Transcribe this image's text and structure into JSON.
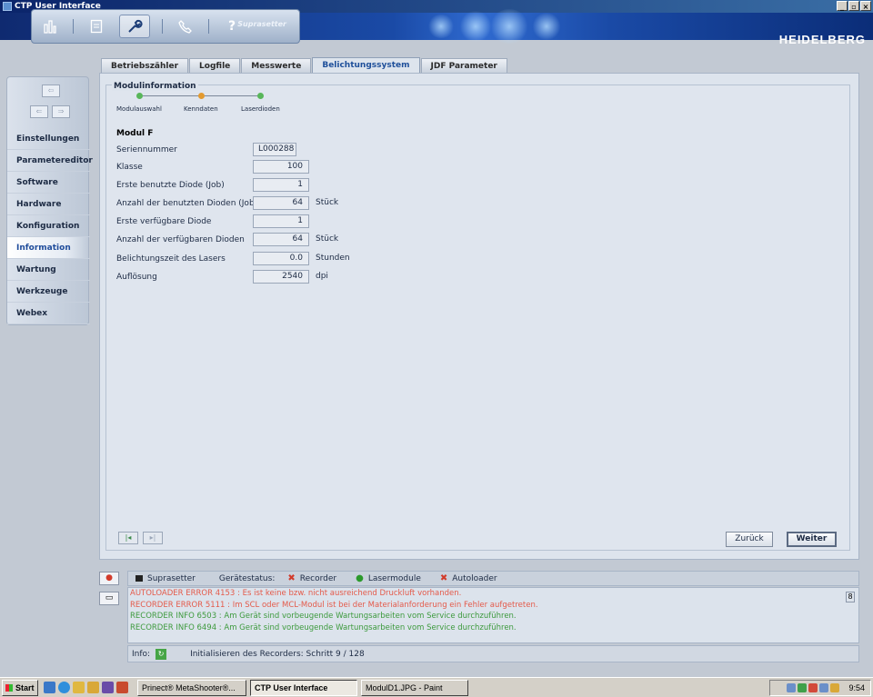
{
  "window": {
    "title": "CTP User Interface"
  },
  "header": {
    "product": "Suprasetter",
    "brand": "HEIDELBERG"
  },
  "sidebar": {
    "items": [
      {
        "label": "Einstellungen"
      },
      {
        "label": "Parametereditor"
      },
      {
        "label": "Software"
      },
      {
        "label": "Hardware"
      },
      {
        "label": "Konfiguration"
      },
      {
        "label": "Information",
        "active": true
      },
      {
        "label": "Wartung"
      },
      {
        "label": "Werkzeuge"
      },
      {
        "label": "Webex"
      }
    ]
  },
  "tabs": [
    {
      "label": "Betriebszähler"
    },
    {
      "label": "Logfile"
    },
    {
      "label": "Messwerte"
    },
    {
      "label": "Belichtungssystem",
      "active": true
    },
    {
      "label": "JDF Parameter"
    }
  ],
  "panel": {
    "legend": "Modulinformation",
    "steps": [
      {
        "label": "Modulauswahl",
        "color": "#58b65a"
      },
      {
        "label": "Kenndaten",
        "color": "#e39a2f"
      },
      {
        "label": "Laserdioden",
        "color": "#58b65a"
      }
    ],
    "module_title": "Modul F",
    "rows": [
      {
        "label": "Seriennummer",
        "value": "L000288",
        "unit": ""
      },
      {
        "label": "Klasse",
        "value": "100",
        "unit": ""
      },
      {
        "label": "Erste benutzte Diode (Job)",
        "value": "1",
        "unit": ""
      },
      {
        "label": "Anzahl der benutzten Dioden (Job)",
        "value": "64",
        "unit": "Stück"
      },
      {
        "label": "Erste verfügbare Diode",
        "value": "1",
        "unit": ""
      },
      {
        "label": "Anzahl der verfügbaren Dioden",
        "value": "64",
        "unit": "Stück"
      },
      {
        "label": "Belichtungszeit des Lasers",
        "value": "0.0",
        "unit": "Stunden"
      },
      {
        "label": "Auflösung",
        "value": "2540",
        "unit": "dpi"
      }
    ],
    "back_label": "Zurück",
    "next_label": "Weiter"
  },
  "status": {
    "device": "Suprasetter",
    "device_status_label": "Gerätestatus:",
    "items": [
      {
        "label": "Recorder",
        "state": "error"
      },
      {
        "label": "Lasermodule",
        "state": "ok"
      },
      {
        "label": "Autoloader",
        "state": "error"
      }
    ],
    "count": "8",
    "messages": [
      {
        "type": "err",
        "text": "AUTOLOADER ERROR 4153 : Es ist keine bzw. nicht ausreichend Druckluft vorhanden."
      },
      {
        "type": "err",
        "text": "RECORDER ERROR 5111 : Im SCL oder MCL-Modul ist bei der Materialanforderung ein Fehler aufgetreten."
      },
      {
        "type": "info",
        "text": "RECORDER INFO 6503 : Am Gerät sind vorbeugende Wartungsarbeiten vom Service durchzuführen."
      },
      {
        "type": "info",
        "text": "RECORDER INFO 6494 : Am Gerät sind vorbeugende Wartungsarbeiten vom Service durchzuführen."
      }
    ],
    "info_label": "Info:",
    "info_text": "Initialisieren des Recorders: Schritt  9 / 128"
  },
  "taskbar": {
    "start_label": "Start",
    "tasks": [
      {
        "label": "Prinect® MetaShooter®..."
      },
      {
        "label": "CTP User Interface",
        "active": true
      },
      {
        "label": "ModulD1.JPG - Paint"
      }
    ],
    "clock": "9:54"
  }
}
